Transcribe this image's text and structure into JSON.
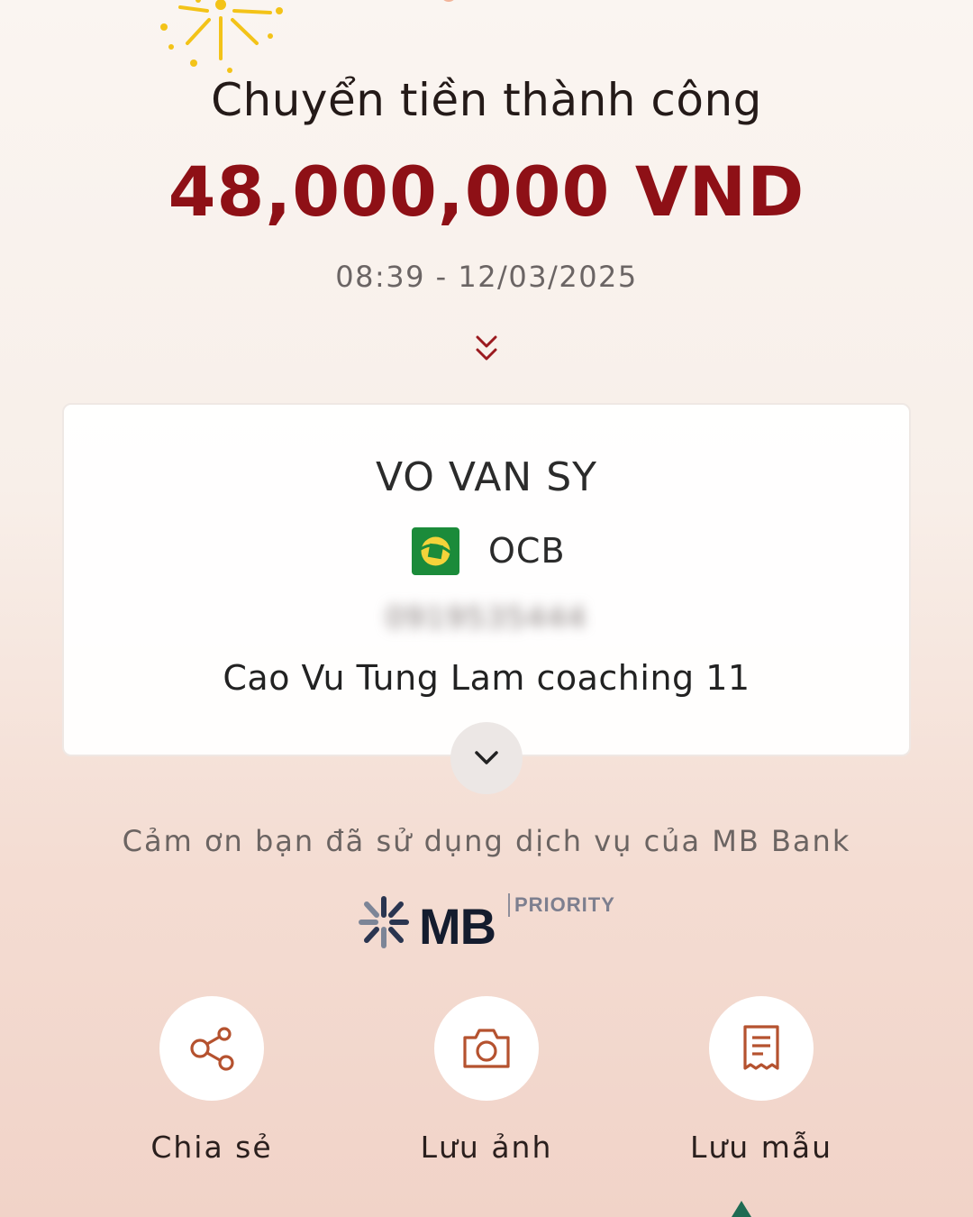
{
  "header": {
    "title": "Chuyển tiền thành công",
    "amount": "48,000,000 VND",
    "datetime": "08:39 - 12/03/2025"
  },
  "recipient": {
    "name": "VO VAN SY",
    "bank": "OCB",
    "account_number": "0919535444",
    "description": "Cao Vu Tung Lam coaching 11"
  },
  "footer": {
    "thanks": "Cảm ơn bạn đã sử dụng dịch vụ của MB Bank",
    "brand": "MB",
    "brand_tier": "PRIORITY"
  },
  "actions": [
    {
      "label": "Chia sẻ",
      "icon": "share-icon"
    },
    {
      "label": "Lưu ảnh",
      "icon": "camera-icon"
    },
    {
      "label": "Lưu mẫu",
      "icon": "receipt-icon"
    }
  ],
  "colors": {
    "amount": "#8e1016",
    "accent": "#b5522f",
    "bank_logo": "#1b8b3a",
    "brand_text": "#141c2e"
  }
}
